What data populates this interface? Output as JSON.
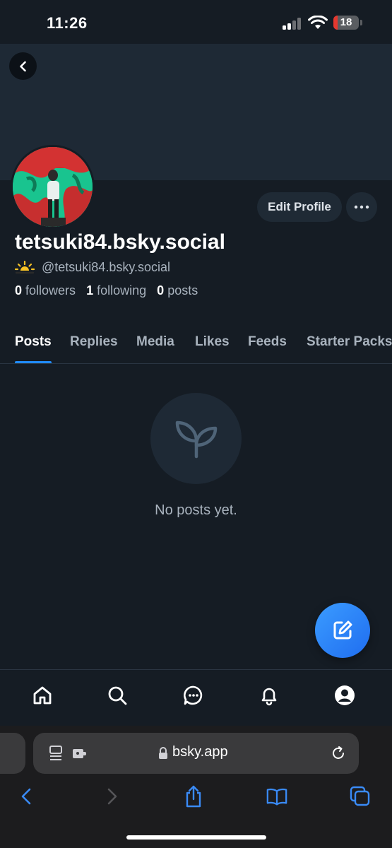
{
  "status_bar": {
    "time": "11:26",
    "battery": "18"
  },
  "profile": {
    "display_name": "tetsuki84.bsky.social",
    "handle": "@tetsuki84.bsky.social",
    "edit_button": "Edit Profile",
    "stats": {
      "followers_count": "0",
      "followers_label": "followers",
      "following_count": "1",
      "following_label": "following",
      "posts_count": "0",
      "posts_label": "posts"
    }
  },
  "tabs": [
    {
      "label": "Posts",
      "active": true
    },
    {
      "label": "Replies",
      "active": false
    },
    {
      "label": "Media",
      "active": false
    },
    {
      "label": "Likes",
      "active": false
    },
    {
      "label": "Feeds",
      "active": false
    },
    {
      "label": "Starter Packs",
      "active": false
    }
  ],
  "empty_state": {
    "text": "No posts yet.",
    "icon": "sprout-icon"
  },
  "bottom_nav": [
    "home-icon",
    "search-icon",
    "chat-icon",
    "bell-icon",
    "profile-icon"
  ],
  "browser": {
    "url": "bsky.app"
  },
  "colors": {
    "accent": "#208bfe",
    "background": "#151c24",
    "banner": "#1e2935"
  }
}
